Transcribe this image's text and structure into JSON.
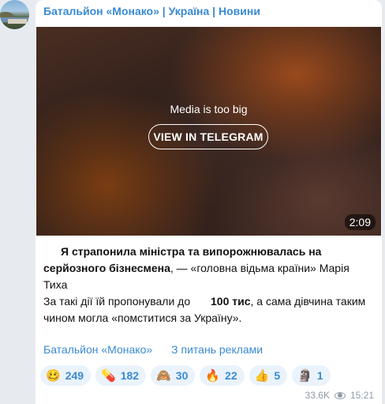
{
  "channel": {
    "title": "Батальйон «Монако» | Україна | Новини"
  },
  "media": {
    "notice": "Media is too big",
    "button_label": "VIEW IN TELEGRAM",
    "duration": "2:09"
  },
  "post": {
    "p1_bold": "Я страпонила міністра та випорожнювалась на серйозного бізнесмена",
    "p1_rest": ", — «головна відьма країни» Марія Тиха",
    "p2_start": "За такі дії їй пропонували до",
    "p2_bold": "100 тис",
    "p2_end": ", а сама дівчина таким чином могла «помститися за Україну»."
  },
  "links": {
    "channel": "Батальйон «Монако»",
    "ads": "З питань реклами"
  },
  "reactions": [
    {
      "icon": "🥴",
      "count": "249"
    },
    {
      "icon": "💊",
      "count": "182"
    },
    {
      "icon": "🙈",
      "count": "30"
    },
    {
      "icon": "🔥",
      "count": "22"
    },
    {
      "icon": "👍",
      "count": "5"
    },
    {
      "icon": "🗿",
      "count": "1"
    }
  ],
  "meta": {
    "views": "33.6K",
    "time": "15:21"
  },
  "colors": {
    "accent": "#3a8ad1",
    "background": "#e7ebf0",
    "bubble": "#ffffff"
  }
}
